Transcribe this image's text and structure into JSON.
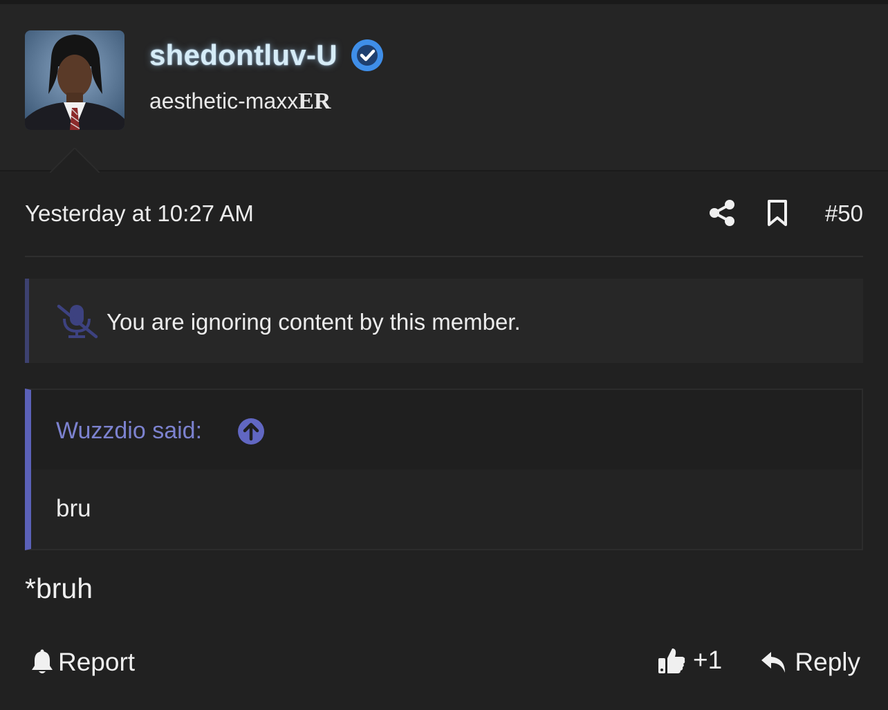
{
  "author": {
    "username": "shedontluv-U",
    "title_main": "aesthetic-maxx",
    "title_suffix": "ER",
    "avatar_icon": "profile-photo",
    "verified_icon": "verified-check-icon"
  },
  "post": {
    "timestamp": "Yesterday at 10:27 AM",
    "number": "#50",
    "body": "*bruh"
  },
  "ignored_notice": {
    "text": "You are ignoring content by this member.",
    "icon": "muted-microphone-icon"
  },
  "quote": {
    "author_label": "Wuzzdio said:",
    "body": "bru"
  },
  "actions": {
    "report_label": "Report",
    "like_count": "+1",
    "reply_label": "Reply"
  },
  "colors": {
    "background": "#212121",
    "accent_quote": "#5b61b8",
    "quote_author": "#7c82cf",
    "verified": "#3f8ee8"
  }
}
